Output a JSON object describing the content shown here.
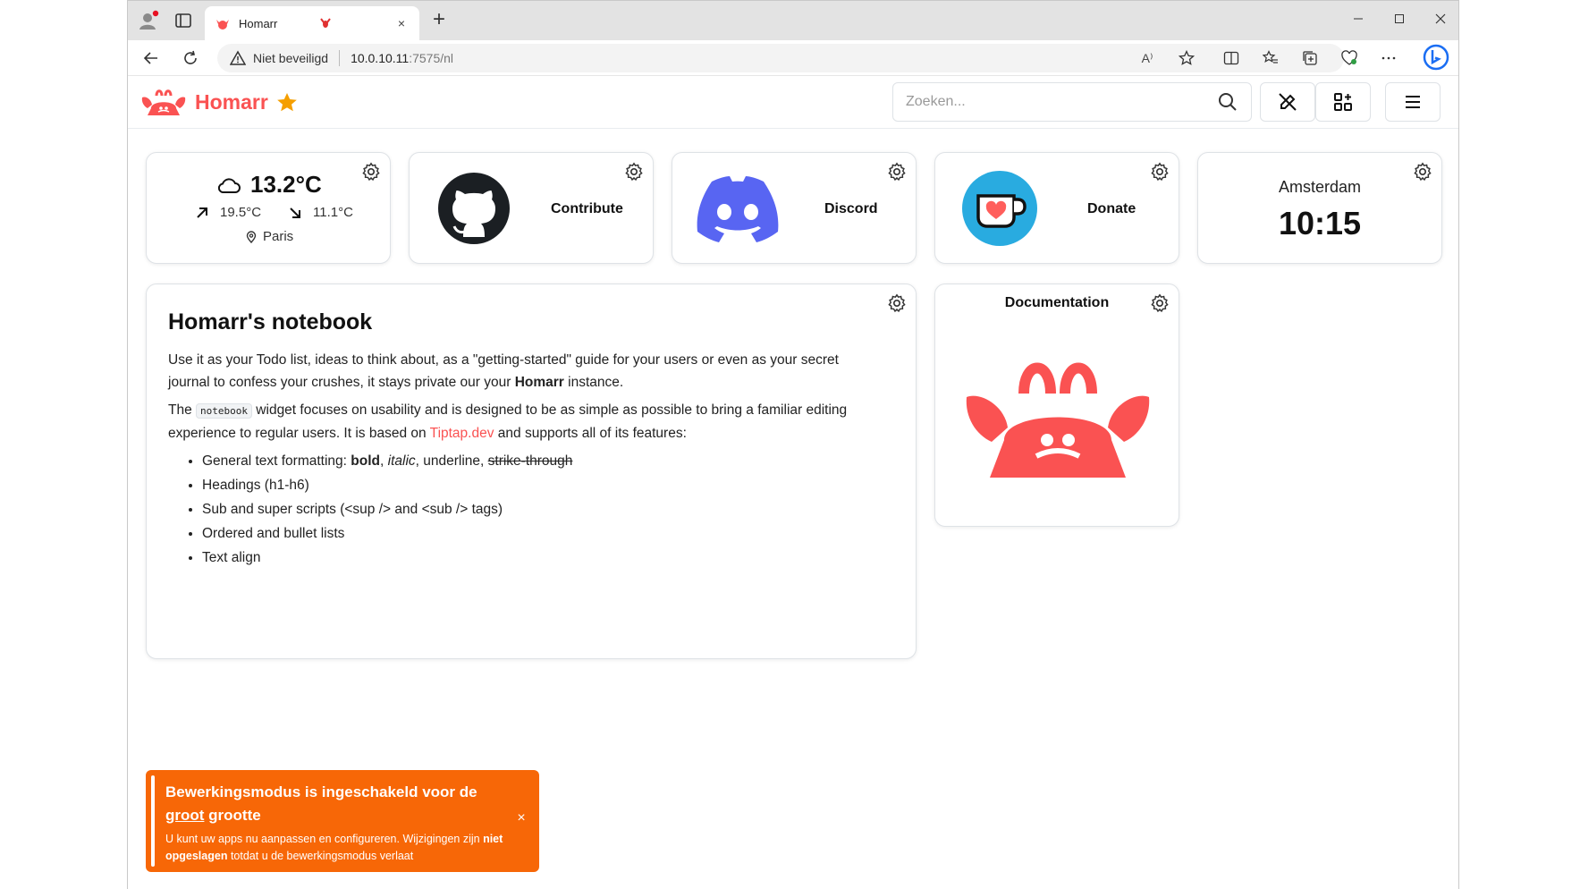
{
  "browser": {
    "tab_title": "Homarr",
    "tab_close": "×",
    "new_tab": "+",
    "security_label": "Niet beveiligd",
    "url_host": "10.0.10.11",
    "url_path": ":7575/nl",
    "read_aloud": "A⁾"
  },
  "header": {
    "brand": "Homarr",
    "search_placeholder": "Zoeken..."
  },
  "tiles": {
    "weather": {
      "temp": "13.2°C",
      "high": "19.5°C",
      "low": "11.1°C",
      "location": "Paris"
    },
    "contribute": {
      "label": "Contribute"
    },
    "discord": {
      "label": "Discord"
    },
    "donate": {
      "label": "Donate"
    },
    "clock": {
      "city": "Amsterdam",
      "time": "10:15"
    },
    "documentation": {
      "label": "Documentation"
    }
  },
  "notebook": {
    "title": "Homarr's notebook",
    "p1_a": "Use it as your Todo list, ideas to think about, as a \"getting-started\" guide for your users or even as your secret journal to confess your crushes, it stays private our your ",
    "p1_bold": "Homarr",
    "p1_b": " instance.",
    "p2_a": "The ",
    "p2_code": "notebook",
    "p2_b": " widget focuses on usability and is designed to be as simple as possible to bring a familiar editing experience to regular users. It is based on ",
    "p2_link": "Tiptap.dev",
    "p2_c": " and supports all of its features:",
    "li1_a": "General text formatting: ",
    "li1_bold": "bold",
    "li1_sep1": ", ",
    "li1_italic": "italic",
    "li1_sep2": ", underline, ",
    "li1_strike": "strike-through",
    "li2": "Headings (h1-h6)",
    "li3": "Sub and super scripts (<sup /> and <sub /> tags)",
    "li4": "Ordered and bullet lists",
    "li5": "Text align"
  },
  "toast": {
    "title_a": "Bewerkingsmodus is ingeschakeld voor de ",
    "title_u": "groot",
    "title_b": " grootte",
    "msg_a": "U kunt uw apps nu aanpassen en configureren. Wijzigingen zijn ",
    "msg_bold": "niet opgeslagen",
    "msg_b": " totdat u de bewerkingsmodus verlaat",
    "close": "×"
  },
  "colors": {
    "brand": "#fa5252",
    "toast": "#f76707",
    "discord": "#5865f2",
    "kofi": "#29abe0"
  }
}
